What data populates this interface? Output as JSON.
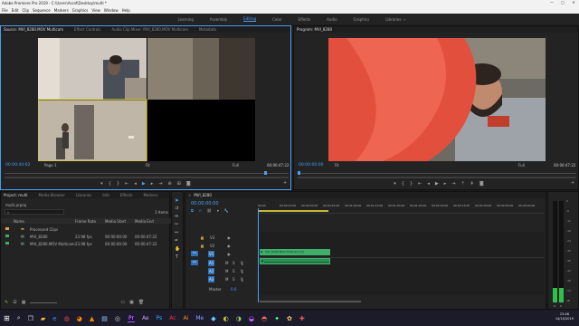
{
  "window": {
    "title": "Adobe Premiere Pro 2019 - C:\\Users\\Asraf\\Desktop\\multi *",
    "controls": [
      "—",
      "□",
      "✕"
    ]
  },
  "menu": [
    "File",
    "Edit",
    "Clip",
    "Sequence",
    "Markers",
    "Graphics",
    "View",
    "Window",
    "Help"
  ],
  "workspaces": {
    "items": [
      "Learning",
      "Assembly",
      "Editing",
      "Color",
      "Effects",
      "Audio",
      "Graphics",
      "Libraries"
    ],
    "active": "Editing",
    "more": "»"
  },
  "source": {
    "tabs": [
      "Source: MVI_8280.MOV Multicam",
      "Effect Controls",
      "Audio Clip Mixer: MVI_8280.MOV Multicam",
      "Metadata"
    ],
    "timecode_left": "00:00:44:02",
    "fit": "Fit",
    "fraction": "Full",
    "timecode_right": "00:00:47:22",
    "page": "Page 1"
  },
  "program": {
    "title": "Program: MVI_8280",
    "timecode_left": "00:00:00:00",
    "fit": "Fit",
    "fraction": "Full",
    "timecode_right": "00:00:47:22"
  },
  "project": {
    "tabs": [
      "Project: multi",
      "Media Browser",
      "Libraries",
      "Info",
      "Effects",
      "Markers"
    ],
    "file": "multi.prproj",
    "search_placeholder": "",
    "count": "3 Items",
    "columns": [
      "Name",
      "Frame Rate",
      "Media Start",
      "Media End"
    ],
    "rows": [
      {
        "name": "Processed Clips",
        "fps": "",
        "start": "",
        "end": "",
        "color": "#e8a23a",
        "type": "folder"
      },
      {
        "name": "MVI_8280",
        "fps": "23.98 fps",
        "start": "00:00:00:00",
        "end": "00:00:47:22",
        "color": "#3fae6a",
        "type": "seq"
      },
      {
        "name": "MVI_8280.MOV Multicam",
        "fps": "23.98 fps",
        "start": "00:00:00:00",
        "end": "00:00:47:22",
        "color": "#3fae6a",
        "type": "seq"
      }
    ]
  },
  "timeline": {
    "tab": "MVI_8280",
    "timecode": "00:00:00:00",
    "ruler": [
      "00:00",
      "00:00:15:00",
      "00:00:30:00",
      "00:00:45:00",
      "00:01:00:00",
      "00:01:15:00",
      "00:01:30:00",
      "00:01:45:00",
      "00:02:00:00",
      "00:02:15:00",
      "00:02:30:00",
      "00:02:45:00",
      "00:03:00:00"
    ],
    "video_tracks": [
      "V3",
      "V2",
      "V1"
    ],
    "audio_tracks": [
      "A1",
      "A2",
      "A3"
    ],
    "master": "Master",
    "master_val": "0.0",
    "clip_label": "MVI_8280.MOV Multicam [V]"
  },
  "meters": {
    "labels": [
      "0",
      "-6",
      "-12",
      "-18",
      "-24",
      "-30",
      "-36",
      "-42",
      "-48",
      "-54",
      "dB"
    ],
    "solo": "S",
    "solo2": "S"
  },
  "taskbar": {
    "time": "23:06",
    "date": "14/10/2019"
  },
  "colors": {
    "accent": "#4a9ff5",
    "clip": "#3fae6a"
  }
}
